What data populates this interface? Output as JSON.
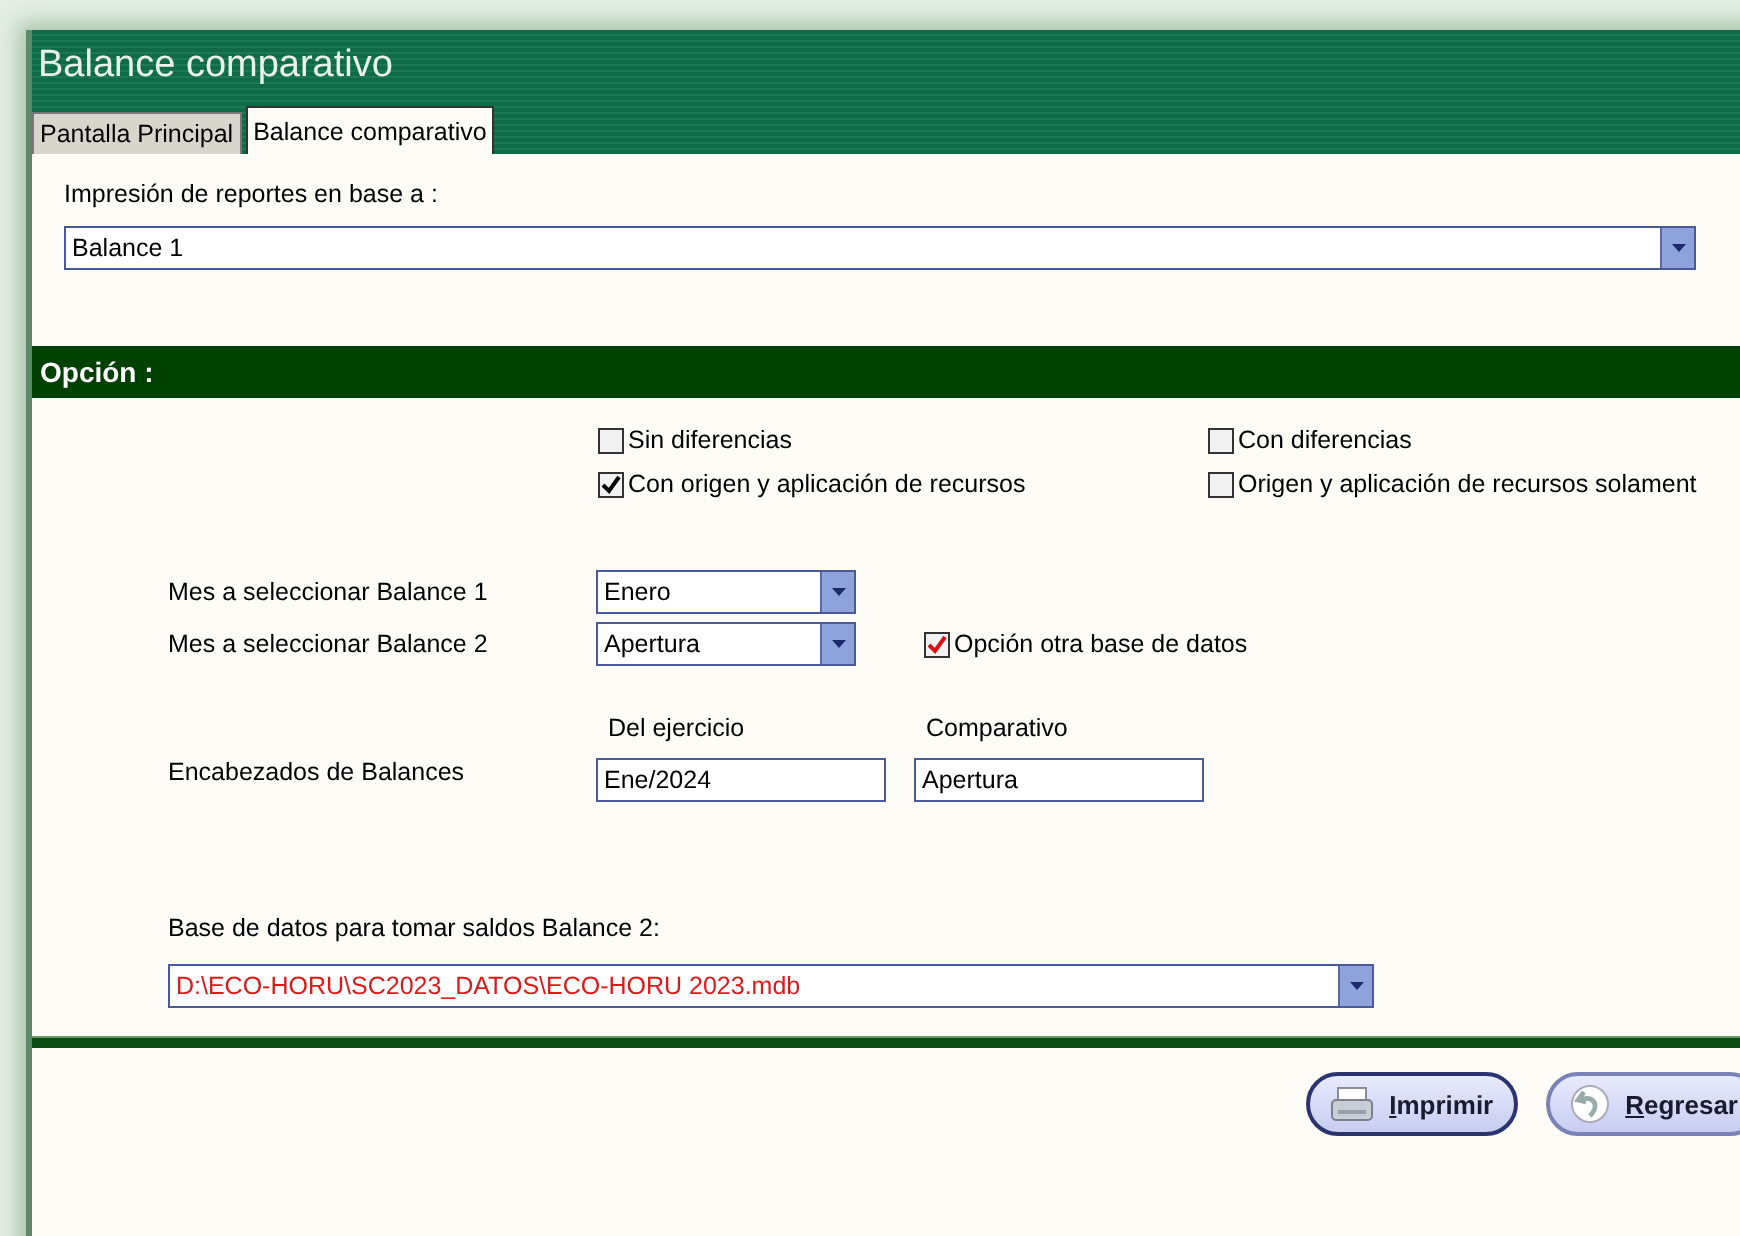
{
  "window": {
    "title": "Balance comparativo"
  },
  "tabs": [
    {
      "label": "Pantalla Principal",
      "selected": false
    },
    {
      "label": "Balance comparativo",
      "selected": true
    }
  ],
  "report_base": {
    "label": "Impresión de reportes en base a :",
    "value": "Balance 1"
  },
  "options_header": "Opción :",
  "options": [
    {
      "label": "Sin diferencias",
      "checked": false
    },
    {
      "label": "Con diferencias",
      "checked": false
    },
    {
      "label": "Con origen y aplicación de recursos",
      "checked": true
    },
    {
      "label": "Origen y aplicación de recursos solament",
      "checked": false
    }
  ],
  "month_1": {
    "label": "Mes a seleccionar Balance 1",
    "value": "Enero"
  },
  "month_2": {
    "label": "Mes a seleccionar Balance 2",
    "value": "Apertura"
  },
  "other_database": {
    "label": "Opción otra base de datos",
    "checked": true
  },
  "headers": {
    "label": "Encabezados de Balances",
    "fields": [
      {
        "label": "Del ejercicio",
        "value": "Ene/2024"
      },
      {
        "label": "Comparativo",
        "value": "Apertura"
      }
    ]
  },
  "database": {
    "label": "Base de datos para tomar saldos Balance 2:",
    "value": "D:\\ECO-HORU\\SC2023_DATOS\\ECO-HORU 2023.mdb"
  },
  "buttons": [
    {
      "label": "Imprimir",
      "kind": "print"
    },
    {
      "label": "Regresar",
      "kind": "back"
    }
  ]
}
